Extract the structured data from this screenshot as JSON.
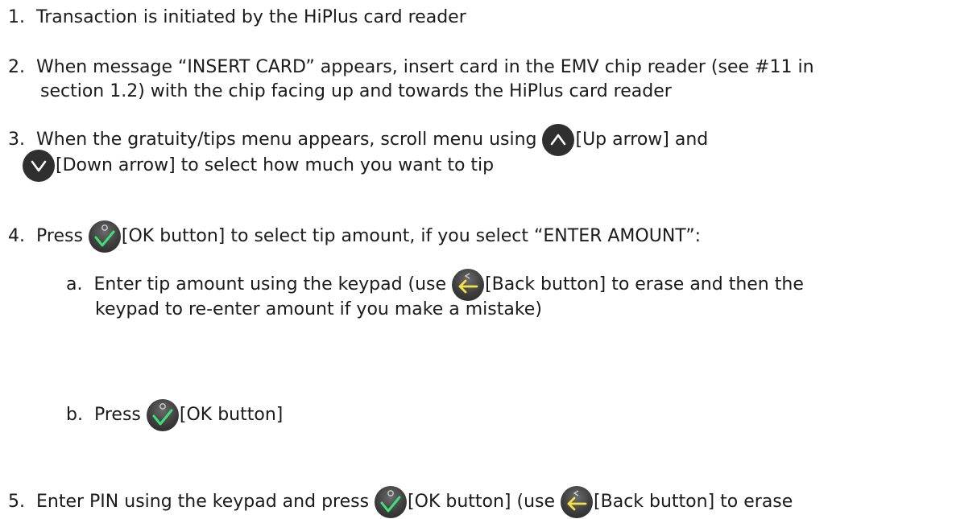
{
  "steps": [
    {
      "num": "1.",
      "text": "Transaction is initiated by the HiPlus card reader"
    },
    {
      "num": "2.",
      "line1": "When message “INSERT CARD” appears, insert card in the EMV chip reader (see #11 in",
      "line2": "section 1.2)  with the chip facing up and towards the HiPlus card reader"
    },
    {
      "num": "3.",
      "line1_pre": "When the gratuity/tips menu appears, scroll menu using ",
      "up_label": "[Up arrow] and",
      "down_label": "[Down arrow] to select how much you want to tip"
    },
    {
      "num": "4.",
      "pre": "Press ",
      "post": "[OK button] to select tip amount, if you select “ENTER AMOUNT”:"
    },
    {
      "letter": "a.",
      "line1_pre": "Enter tip amount using the keypad (use ",
      "line1_post": "[Back button] to erase and then the",
      "line2": "keypad to re-enter amount if you make a mistake)"
    },
    {
      "letter": "b.",
      "pre": "Press ",
      "post": "[OK button]"
    },
    {
      "num": "5.",
      "pre": "Enter PIN using the keypad and press ",
      "mid": "[OK button] (use ",
      "post": "[Back button] to erase"
    }
  ],
  "icons": {
    "up": "up-arrow-icon",
    "down": "down-arrow-icon",
    "ok": "ok-check-icon",
    "back": "back-arrow-icon"
  },
  "colors": {
    "text": "#1b1b1b",
    "arrow_button": "#2f2f2f",
    "ok_check": "#3ee07a",
    "back_arrow": "#f2e24a"
  }
}
